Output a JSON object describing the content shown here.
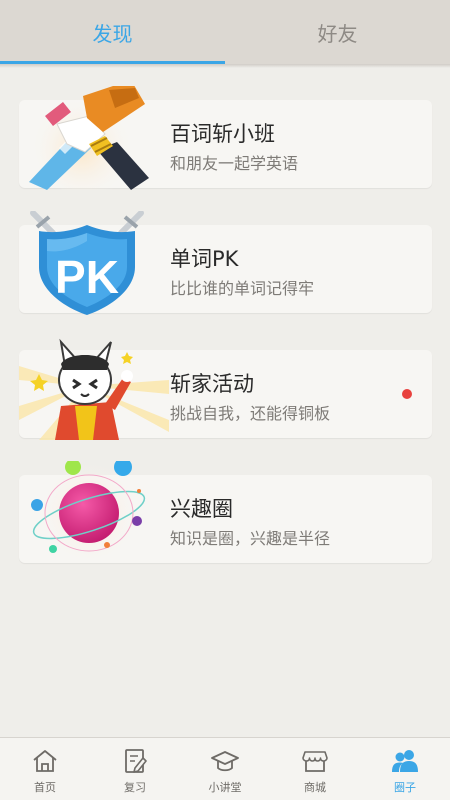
{
  "tabs": {
    "discover": "发现",
    "friends": "好友"
  },
  "cards": [
    {
      "title": "百词斩小班",
      "subtitle": "和朋友一起学英语",
      "icon": "handshake-art"
    },
    {
      "title": "单词PK",
      "subtitle": "比比谁的单词记得牢",
      "icon": "pk-shield-art",
      "art_text": "PK"
    },
    {
      "title": "斩家活动",
      "subtitle": "挑战自我，还能得铜板",
      "icon": "cat-mascot-art",
      "has_new_dot": true
    },
    {
      "title": "兴趣圈",
      "subtitle": "知识是圈，兴趣是半径",
      "icon": "planet-art"
    }
  ],
  "nav": {
    "home": "首页",
    "review": "复习",
    "lecture": "小讲堂",
    "mall": "商城",
    "circle": "圈子"
  },
  "colors": {
    "accent": "#3ba6e6",
    "badge": "#e8413e",
    "background": "#efeeea",
    "card": "#f7f6f3"
  }
}
